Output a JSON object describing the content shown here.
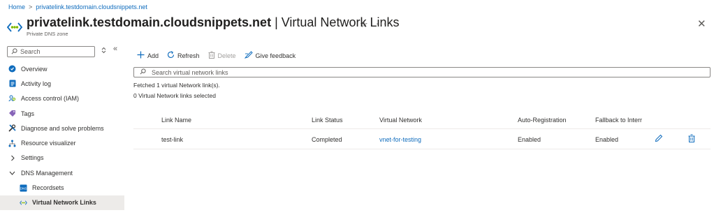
{
  "breadcrumb": {
    "home": "Home",
    "separator": ">",
    "current": "privatelink.testdomain.cloudsnippets.net"
  },
  "header": {
    "title_bold": "privatelink.testdomain.cloudsnippets.net",
    "title_rest": " | Virtual Network Links",
    "subtitle": "Private DNS zone",
    "star": "☆",
    "more": "···",
    "close": "✕"
  },
  "sidebar": {
    "search_placeholder": "Search",
    "items": [
      {
        "label": "Overview",
        "icon": "overview-icon"
      },
      {
        "label": "Activity log",
        "icon": "activity-log-icon"
      },
      {
        "label": "Access control (IAM)",
        "icon": "iam-icon"
      },
      {
        "label": "Tags",
        "icon": "tag-icon"
      },
      {
        "label": "Diagnose and solve problems",
        "icon": "wrench-icon"
      },
      {
        "label": "Resource visualizer",
        "icon": "visualizer-icon"
      },
      {
        "label": "Settings",
        "icon": "chevron-right-icon"
      },
      {
        "label": "DNS Management",
        "icon": "chevron-down-icon"
      },
      {
        "label": "Recordsets",
        "icon": "recordsets-icon"
      },
      {
        "label": "Virtual Network Links",
        "icon": "vnet-link-icon"
      }
    ]
  },
  "toolbar": {
    "add": "Add",
    "refresh": "Refresh",
    "delete": "Delete",
    "feedback": "Give feedback"
  },
  "main": {
    "search_placeholder": "Search virtual network links",
    "fetched": "Fetched 1 virtual Network link(s).",
    "selected": "0 Virtual Network links selected"
  },
  "table": {
    "columns": [
      "Link Name",
      "Link Status",
      "Virtual Network",
      "Auto-Registration",
      "Fallback to Interr"
    ],
    "rows": [
      {
        "link_name": "test-link",
        "status": "Completed",
        "vnet": "vnet-for-testing",
        "auto_registration": "Enabled",
        "fallback": "Enabled"
      }
    ]
  },
  "colors": {
    "accent": "#0f6cbd",
    "active_bg": "#edebe9",
    "text": "#323130"
  }
}
